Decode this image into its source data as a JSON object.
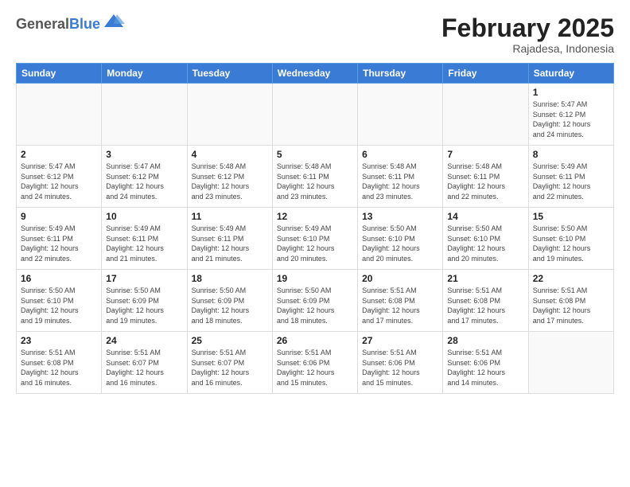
{
  "header": {
    "logo_general": "General",
    "logo_blue": "Blue",
    "title": "February 2025",
    "subtitle": "Rajadesa, Indonesia"
  },
  "weekdays": [
    "Sunday",
    "Monday",
    "Tuesday",
    "Wednesday",
    "Thursday",
    "Friday",
    "Saturday"
  ],
  "weeks": [
    [
      {
        "day": "",
        "info": ""
      },
      {
        "day": "",
        "info": ""
      },
      {
        "day": "",
        "info": ""
      },
      {
        "day": "",
        "info": ""
      },
      {
        "day": "",
        "info": ""
      },
      {
        "day": "",
        "info": ""
      },
      {
        "day": "1",
        "info": "Sunrise: 5:47 AM\nSunset: 6:12 PM\nDaylight: 12 hours\nand 24 minutes."
      }
    ],
    [
      {
        "day": "2",
        "info": "Sunrise: 5:47 AM\nSunset: 6:12 PM\nDaylight: 12 hours\nand 24 minutes."
      },
      {
        "day": "3",
        "info": "Sunrise: 5:47 AM\nSunset: 6:12 PM\nDaylight: 12 hours\nand 24 minutes."
      },
      {
        "day": "4",
        "info": "Sunrise: 5:48 AM\nSunset: 6:12 PM\nDaylight: 12 hours\nand 23 minutes."
      },
      {
        "day": "5",
        "info": "Sunrise: 5:48 AM\nSunset: 6:11 PM\nDaylight: 12 hours\nand 23 minutes."
      },
      {
        "day": "6",
        "info": "Sunrise: 5:48 AM\nSunset: 6:11 PM\nDaylight: 12 hours\nand 23 minutes."
      },
      {
        "day": "7",
        "info": "Sunrise: 5:48 AM\nSunset: 6:11 PM\nDaylight: 12 hours\nand 22 minutes."
      },
      {
        "day": "8",
        "info": "Sunrise: 5:49 AM\nSunset: 6:11 PM\nDaylight: 12 hours\nand 22 minutes."
      }
    ],
    [
      {
        "day": "9",
        "info": "Sunrise: 5:49 AM\nSunset: 6:11 PM\nDaylight: 12 hours\nand 22 minutes."
      },
      {
        "day": "10",
        "info": "Sunrise: 5:49 AM\nSunset: 6:11 PM\nDaylight: 12 hours\nand 21 minutes."
      },
      {
        "day": "11",
        "info": "Sunrise: 5:49 AM\nSunset: 6:11 PM\nDaylight: 12 hours\nand 21 minutes."
      },
      {
        "day": "12",
        "info": "Sunrise: 5:49 AM\nSunset: 6:10 PM\nDaylight: 12 hours\nand 20 minutes."
      },
      {
        "day": "13",
        "info": "Sunrise: 5:50 AM\nSunset: 6:10 PM\nDaylight: 12 hours\nand 20 minutes."
      },
      {
        "day": "14",
        "info": "Sunrise: 5:50 AM\nSunset: 6:10 PM\nDaylight: 12 hours\nand 20 minutes."
      },
      {
        "day": "15",
        "info": "Sunrise: 5:50 AM\nSunset: 6:10 PM\nDaylight: 12 hours\nand 19 minutes."
      }
    ],
    [
      {
        "day": "16",
        "info": "Sunrise: 5:50 AM\nSunset: 6:10 PM\nDaylight: 12 hours\nand 19 minutes."
      },
      {
        "day": "17",
        "info": "Sunrise: 5:50 AM\nSunset: 6:09 PM\nDaylight: 12 hours\nand 19 minutes."
      },
      {
        "day": "18",
        "info": "Sunrise: 5:50 AM\nSunset: 6:09 PM\nDaylight: 12 hours\nand 18 minutes."
      },
      {
        "day": "19",
        "info": "Sunrise: 5:50 AM\nSunset: 6:09 PM\nDaylight: 12 hours\nand 18 minutes."
      },
      {
        "day": "20",
        "info": "Sunrise: 5:51 AM\nSunset: 6:08 PM\nDaylight: 12 hours\nand 17 minutes."
      },
      {
        "day": "21",
        "info": "Sunrise: 5:51 AM\nSunset: 6:08 PM\nDaylight: 12 hours\nand 17 minutes."
      },
      {
        "day": "22",
        "info": "Sunrise: 5:51 AM\nSunset: 6:08 PM\nDaylight: 12 hours\nand 17 minutes."
      }
    ],
    [
      {
        "day": "23",
        "info": "Sunrise: 5:51 AM\nSunset: 6:08 PM\nDaylight: 12 hours\nand 16 minutes."
      },
      {
        "day": "24",
        "info": "Sunrise: 5:51 AM\nSunset: 6:07 PM\nDaylight: 12 hours\nand 16 minutes."
      },
      {
        "day": "25",
        "info": "Sunrise: 5:51 AM\nSunset: 6:07 PM\nDaylight: 12 hours\nand 16 minutes."
      },
      {
        "day": "26",
        "info": "Sunrise: 5:51 AM\nSunset: 6:06 PM\nDaylight: 12 hours\nand 15 minutes."
      },
      {
        "day": "27",
        "info": "Sunrise: 5:51 AM\nSunset: 6:06 PM\nDaylight: 12 hours\nand 15 minutes."
      },
      {
        "day": "28",
        "info": "Sunrise: 5:51 AM\nSunset: 6:06 PM\nDaylight: 12 hours\nand 14 minutes."
      },
      {
        "day": "",
        "info": ""
      }
    ]
  ]
}
